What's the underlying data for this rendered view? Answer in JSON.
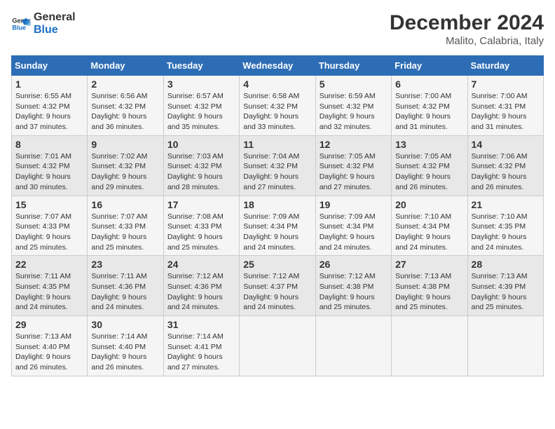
{
  "logo": {
    "line1": "General",
    "line2": "Blue"
  },
  "title": "December 2024",
  "subtitle": "Malito, Calabria, Italy",
  "weekdays": [
    "Sunday",
    "Monday",
    "Tuesday",
    "Wednesday",
    "Thursday",
    "Friday",
    "Saturday"
  ],
  "weeks": [
    [
      {
        "day": "1",
        "info": "Sunrise: 6:55 AM\nSunset: 4:32 PM\nDaylight: 9 hours\nand 37 minutes."
      },
      {
        "day": "2",
        "info": "Sunrise: 6:56 AM\nSunset: 4:32 PM\nDaylight: 9 hours\nand 36 minutes."
      },
      {
        "day": "3",
        "info": "Sunrise: 6:57 AM\nSunset: 4:32 PM\nDaylight: 9 hours\nand 35 minutes."
      },
      {
        "day": "4",
        "info": "Sunrise: 6:58 AM\nSunset: 4:32 PM\nDaylight: 9 hours\nand 33 minutes."
      },
      {
        "day": "5",
        "info": "Sunrise: 6:59 AM\nSunset: 4:32 PM\nDaylight: 9 hours\nand 32 minutes."
      },
      {
        "day": "6",
        "info": "Sunrise: 7:00 AM\nSunset: 4:32 PM\nDaylight: 9 hours\nand 31 minutes."
      },
      {
        "day": "7",
        "info": "Sunrise: 7:00 AM\nSunset: 4:31 PM\nDaylight: 9 hours\nand 31 minutes."
      }
    ],
    [
      {
        "day": "8",
        "info": "Sunrise: 7:01 AM\nSunset: 4:32 PM\nDaylight: 9 hours\nand 30 minutes."
      },
      {
        "day": "9",
        "info": "Sunrise: 7:02 AM\nSunset: 4:32 PM\nDaylight: 9 hours\nand 29 minutes."
      },
      {
        "day": "10",
        "info": "Sunrise: 7:03 AM\nSunset: 4:32 PM\nDaylight: 9 hours\nand 28 minutes."
      },
      {
        "day": "11",
        "info": "Sunrise: 7:04 AM\nSunset: 4:32 PM\nDaylight: 9 hours\nand 27 minutes."
      },
      {
        "day": "12",
        "info": "Sunrise: 7:05 AM\nSunset: 4:32 PM\nDaylight: 9 hours\nand 27 minutes."
      },
      {
        "day": "13",
        "info": "Sunrise: 7:05 AM\nSunset: 4:32 PM\nDaylight: 9 hours\nand 26 minutes."
      },
      {
        "day": "14",
        "info": "Sunrise: 7:06 AM\nSunset: 4:32 PM\nDaylight: 9 hours\nand 26 minutes."
      }
    ],
    [
      {
        "day": "15",
        "info": "Sunrise: 7:07 AM\nSunset: 4:33 PM\nDaylight: 9 hours\nand 25 minutes."
      },
      {
        "day": "16",
        "info": "Sunrise: 7:07 AM\nSunset: 4:33 PM\nDaylight: 9 hours\nand 25 minutes."
      },
      {
        "day": "17",
        "info": "Sunrise: 7:08 AM\nSunset: 4:33 PM\nDaylight: 9 hours\nand 25 minutes."
      },
      {
        "day": "18",
        "info": "Sunrise: 7:09 AM\nSunset: 4:34 PM\nDaylight: 9 hours\nand 24 minutes."
      },
      {
        "day": "19",
        "info": "Sunrise: 7:09 AM\nSunset: 4:34 PM\nDaylight: 9 hours\nand 24 minutes."
      },
      {
        "day": "20",
        "info": "Sunrise: 7:10 AM\nSunset: 4:34 PM\nDaylight: 9 hours\nand 24 minutes."
      },
      {
        "day": "21",
        "info": "Sunrise: 7:10 AM\nSunset: 4:35 PM\nDaylight: 9 hours\nand 24 minutes."
      }
    ],
    [
      {
        "day": "22",
        "info": "Sunrise: 7:11 AM\nSunset: 4:35 PM\nDaylight: 9 hours\nand 24 minutes."
      },
      {
        "day": "23",
        "info": "Sunrise: 7:11 AM\nSunset: 4:36 PM\nDaylight: 9 hours\nand 24 minutes."
      },
      {
        "day": "24",
        "info": "Sunrise: 7:12 AM\nSunset: 4:36 PM\nDaylight: 9 hours\nand 24 minutes."
      },
      {
        "day": "25",
        "info": "Sunrise: 7:12 AM\nSunset: 4:37 PM\nDaylight: 9 hours\nand 24 minutes."
      },
      {
        "day": "26",
        "info": "Sunrise: 7:12 AM\nSunset: 4:38 PM\nDaylight: 9 hours\nand 25 minutes."
      },
      {
        "day": "27",
        "info": "Sunrise: 7:13 AM\nSunset: 4:38 PM\nDaylight: 9 hours\nand 25 minutes."
      },
      {
        "day": "28",
        "info": "Sunrise: 7:13 AM\nSunset: 4:39 PM\nDaylight: 9 hours\nand 25 minutes."
      }
    ],
    [
      {
        "day": "29",
        "info": "Sunrise: 7:13 AM\nSunset: 4:40 PM\nDaylight: 9 hours\nand 26 minutes."
      },
      {
        "day": "30",
        "info": "Sunrise: 7:14 AM\nSunset: 4:40 PM\nDaylight: 9 hours\nand 26 minutes."
      },
      {
        "day": "31",
        "info": "Sunrise: 7:14 AM\nSunset: 4:41 PM\nDaylight: 9 hours\nand 27 minutes."
      },
      {
        "day": "",
        "info": ""
      },
      {
        "day": "",
        "info": ""
      },
      {
        "day": "",
        "info": ""
      },
      {
        "day": "",
        "info": ""
      }
    ]
  ]
}
